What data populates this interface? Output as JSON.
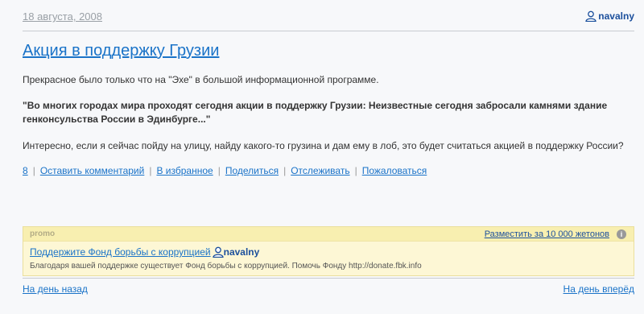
{
  "header": {
    "date": "18 августа, 2008",
    "username": "navalny"
  },
  "post": {
    "title": "Акция в поддержку Грузии",
    "paragraph1": "Прекрасное было только что на \"Эхе\" в большой информационной программе.",
    "quote": "\"Во многих городах мира проходят сегодня акции в поддержку Грузии: Неизвестные сегодня забросали камнями здание генконсульства России в Эдинбурге...\"",
    "paragraph3": "Интересно, если я сейчас пойду на улицу, найду какого-то грузина и дам ему в лоб, это будет считаться акцией в поддержку России?"
  },
  "actions": {
    "comments_count": "8",
    "leave_comment": "Оставить комментарий",
    "favorite": "В избранное",
    "share": "Поделиться",
    "track": "Отслеживать",
    "report": "Пожаловаться"
  },
  "promo": {
    "label": "promo",
    "buy_label": "Разместить за 10 000 жетонов",
    "info_icon": "info-icon",
    "link_text": "Поддержите Фонд борьбы с коррупцией",
    "username": "navalny",
    "description": "Благодаря вашей поддержке существует Фонд борьбы с коррупцией. Помочь Фонду http://donate.fbk.info"
  },
  "nav": {
    "prev": "На день назад",
    "next": "На день вперёд"
  },
  "colors": {
    "link": "#1a73c8",
    "promo_bg": "#fdf7d5",
    "user": "#1b4f9c"
  }
}
